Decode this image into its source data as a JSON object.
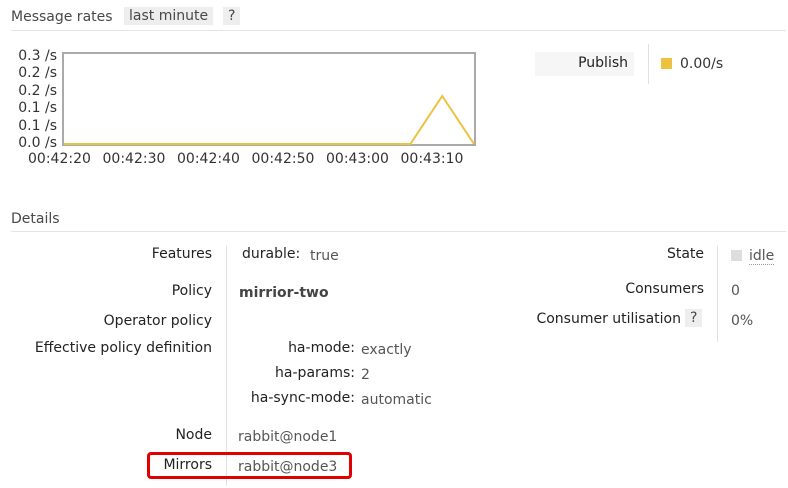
{
  "message_rates": {
    "title": "Message rates",
    "range_label": "last minute",
    "help_label": "?"
  },
  "chart_data": {
    "type": "line",
    "x": [
      "00:42:20",
      "00:42:30",
      "00:42:40",
      "00:42:50",
      "00:43:00",
      "00:43:10"
    ],
    "x_ticks": [
      "00:42:20",
      "00:42:30",
      "00:42:40",
      "00:42:50",
      "00:43:00",
      "00:43:10"
    ],
    "y_ticks": [
      "0.3 /s",
      "0.2 /s",
      "0.2 /s",
      "0.1 /s",
      "0.1 /s",
      "0.0 /s"
    ],
    "ylim": [
      0,
      0.3
    ],
    "series": [
      {
        "name": "Publish",
        "color": "#EDC240",
        "points": [
          {
            "t": 0,
            "v": 0.0
          },
          {
            "t": 54.5,
            "v": 0.0
          },
          {
            "t": 59.5,
            "v": 0.2
          },
          {
            "t": 64.5,
            "v": 0.0
          }
        ]
      }
    ],
    "legend": {
      "label": "Publish",
      "value": "0.00/s",
      "color": "#EDC240"
    },
    "grid": false
  },
  "details": {
    "title": "Details",
    "features_label": "Features",
    "durable_key": "durable:",
    "durable_value": "true",
    "policy_label": "Policy",
    "policy_value": "mirrior-two",
    "operator_policy_label": "Operator policy",
    "effective_policy_label": "Effective policy definition",
    "ha_mode_key": "ha-mode:",
    "ha_mode_value": "exactly",
    "ha_params_key": "ha-params:",
    "ha_params_value": "2",
    "ha_sync_key": "ha-sync-mode:",
    "ha_sync_value": "automatic",
    "node_label": "Node",
    "node_value": "rabbit@node1",
    "mirrors_label": "Mirrors",
    "mirrors_value": "rabbit@node3",
    "state_label": "State",
    "state_value": "idle",
    "consumers_label": "Consumers",
    "consumers_value": "0",
    "consumer_util_label": "Consumer utilisation",
    "consumer_util_help": "?",
    "consumer_util_value": "0%",
    "highlight_color": "#e00000"
  }
}
